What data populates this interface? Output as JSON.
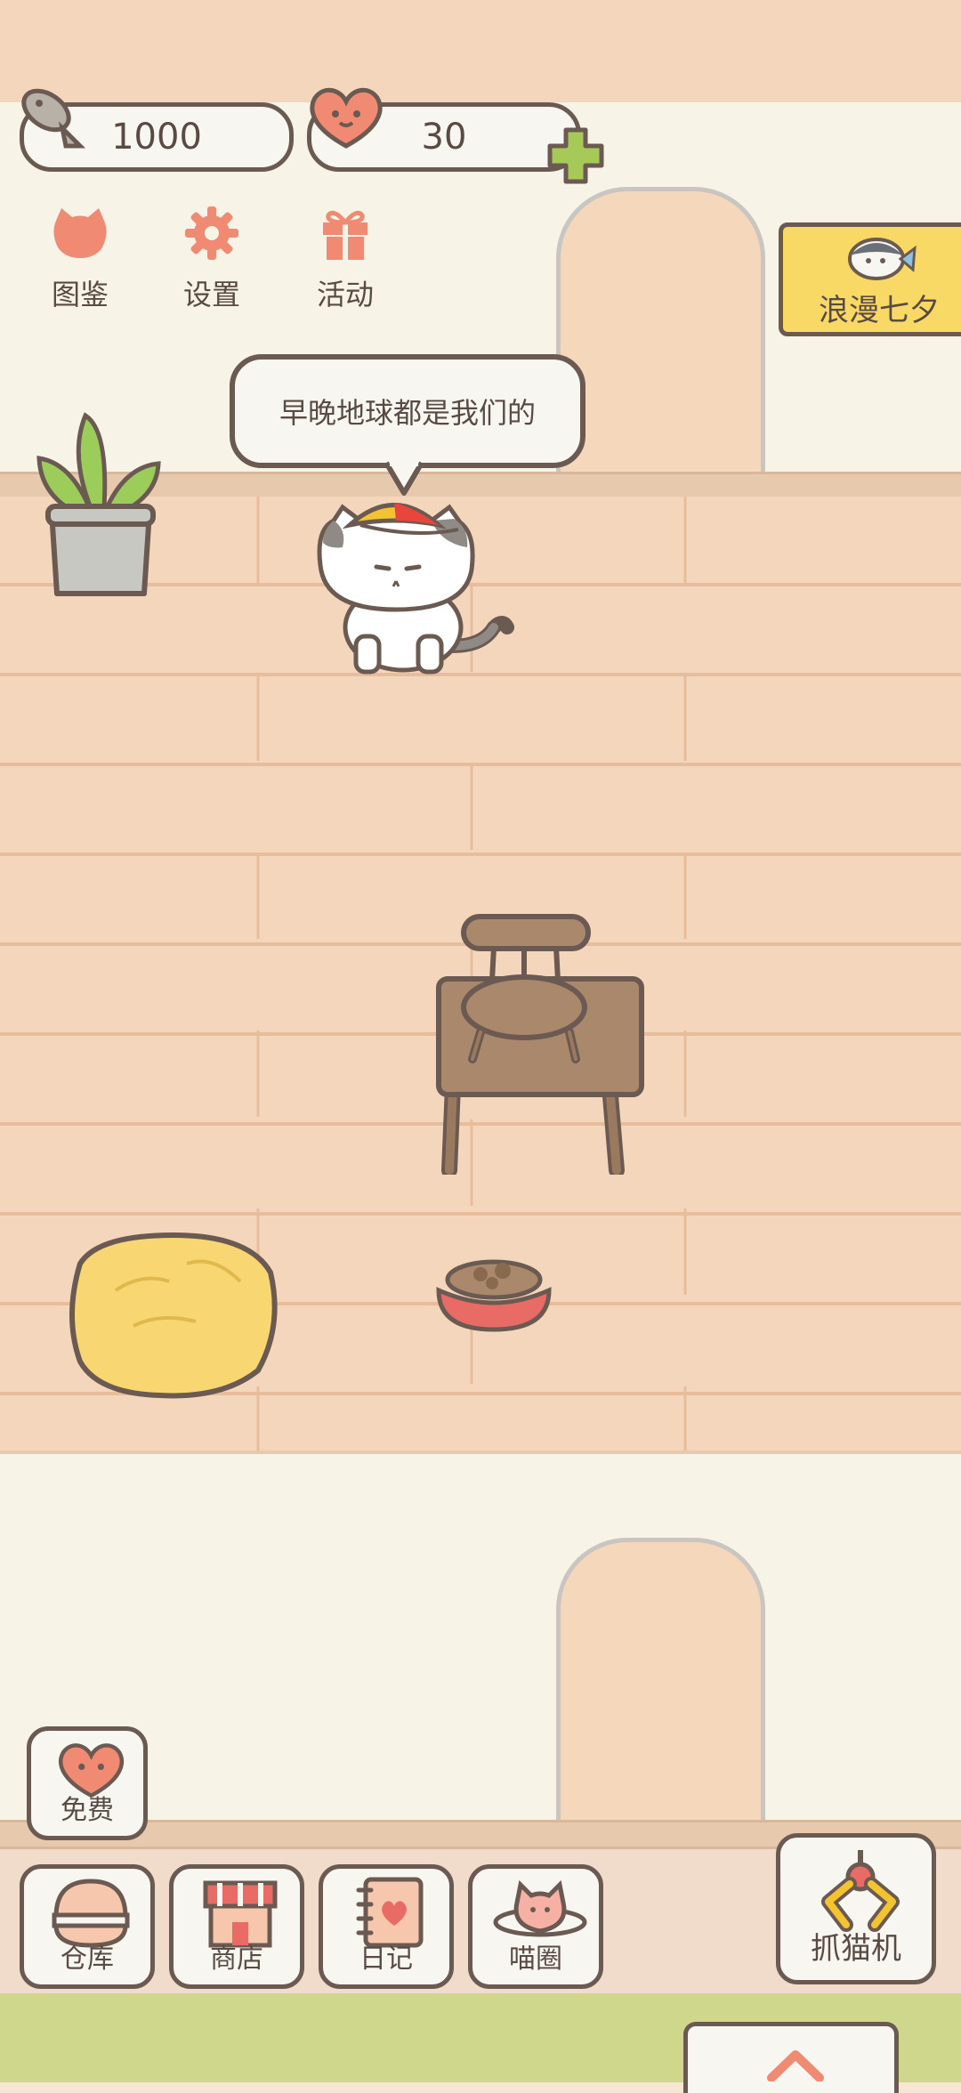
{
  "currency": {
    "fish": "1000",
    "hearts": "30"
  },
  "menu": [
    {
      "label": "图鉴",
      "icon": "cat-head-icon"
    },
    {
      "label": "设置",
      "icon": "gear-icon"
    },
    {
      "label": "活动",
      "icon": "gift-icon"
    }
  ],
  "event_banner": {
    "label": "浪漫七夕"
  },
  "speech_bubble": {
    "text": "早晚地球都是我们的"
  },
  "free_button": {
    "label": "免费"
  },
  "bottom_nav": [
    {
      "label": "仓库",
      "icon": "storage-icon"
    },
    {
      "label": "商店",
      "icon": "shop-icon"
    },
    {
      "label": "日记",
      "icon": "diary-icon"
    },
    {
      "label": "喵圈",
      "icon": "cat-planet-icon"
    }
  ],
  "claw_machine": {
    "label": "抓猫机"
  },
  "colors": {
    "floor": "#f4d6bc",
    "outline": "#6b5a52",
    "accent": "#f08a72",
    "banner": "#f8d966"
  }
}
